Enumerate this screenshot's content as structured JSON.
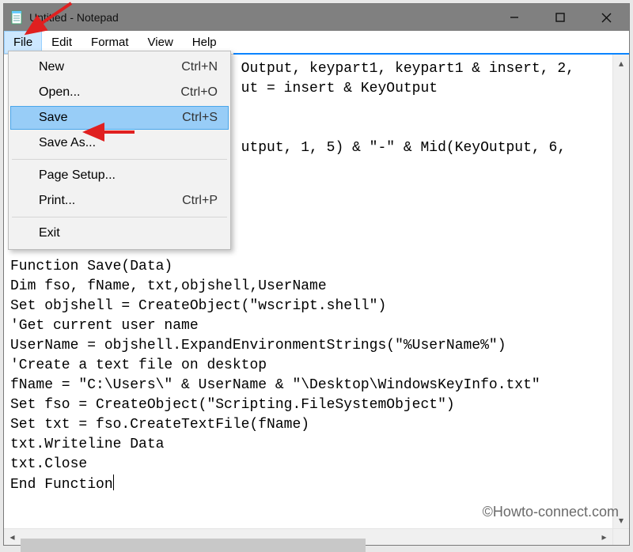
{
  "titlebar": {
    "title": "Untitled - Notepad"
  },
  "menubar": {
    "items": [
      "File",
      "Edit",
      "Format",
      "View",
      "Help"
    ],
    "active": "File"
  },
  "file_menu": {
    "items": [
      {
        "label": "New",
        "shortcut": "Ctrl+N"
      },
      {
        "label": "Open...",
        "shortcut": "Ctrl+O"
      },
      {
        "label": "Save",
        "shortcut": "Ctrl+S",
        "highlight": true
      },
      {
        "label": "Save As...",
        "shortcut": ""
      }
    ],
    "items2": [
      {
        "label": "Page Setup...",
        "shortcut": ""
      },
      {
        "label": "Print...",
        "shortcut": "Ctrl+P"
      }
    ],
    "items3": [
      {
        "label": "Exit",
        "shortcut": ""
      }
    ]
  },
  "editor": {
    "lines": [
      "                           Output, keypart1, keypart1 & insert, 2,",
      "                           ut = insert & KeyOutput",
      "",
      "",
      "                           utput, 1, 5) & \"-\" & Mid(KeyOutput, 6,",
      "",
      "",
      "",
      "",
      "",
      "Function Save(Data)",
      "Dim fso, fName, txt,objshell,UserName",
      "Set objshell = CreateObject(\"wscript.shell\")",
      "'Get current user name",
      "UserName = objshell.ExpandEnvironmentStrings(\"%UserName%\")",
      "'Create a text file on desktop",
      "fName = \"C:\\Users\\\" & UserName & \"\\Desktop\\WindowsKeyInfo.txt\"",
      "Set fso = CreateObject(\"Scripting.FileSystemObject\")",
      "Set txt = fso.CreateTextFile(fName)",
      "txt.Writeline Data",
      "txt.Close",
      "End Function"
    ]
  },
  "watermark": "©Howto-connect.com"
}
